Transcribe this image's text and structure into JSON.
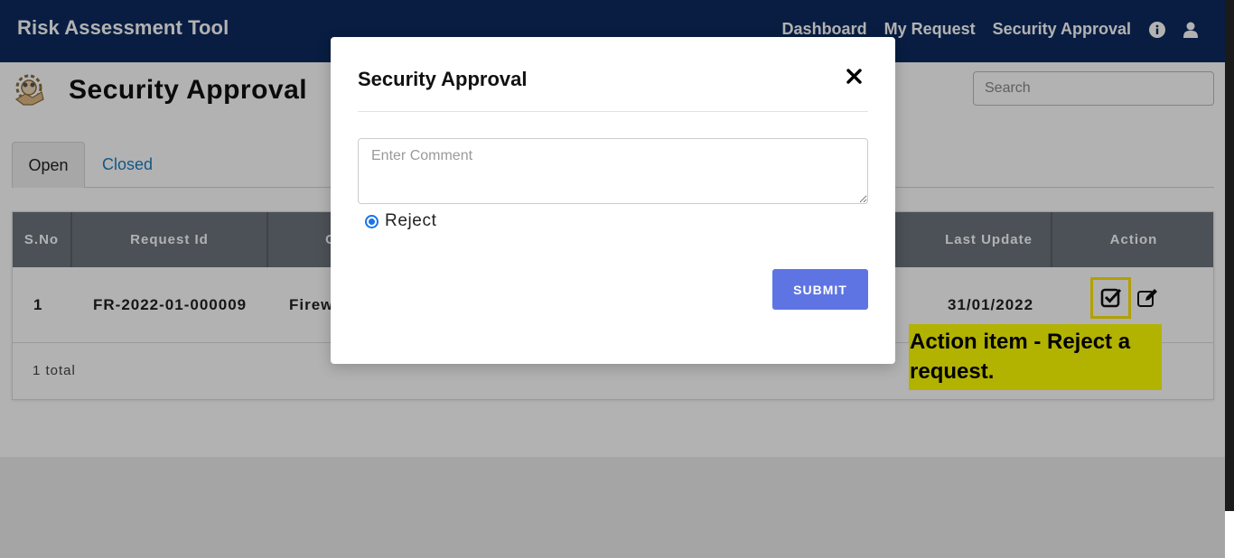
{
  "navbar": {
    "brand": "Risk Assessment Tool",
    "links": [
      "Dashboard",
      "My Request",
      "Security Approval"
    ],
    "icons": [
      "info-icon",
      "user-icon"
    ]
  },
  "page": {
    "title": "Security Approval",
    "search_placeholder": "Search"
  },
  "tabs": [
    "Open",
    "Closed"
  ],
  "table": {
    "columns": [
      "S.No",
      "Request Id",
      "C",
      "Last Update",
      "Action"
    ],
    "rows": [
      {
        "sno": "1",
        "request_id": "FR-2022-01-000009",
        "category": "Firew",
        "last_update": "31/01/2022"
      }
    ],
    "total": "1 total"
  },
  "annotation": {
    "line1": "Action item - Reject a",
    "line2": "request."
  },
  "modal": {
    "title": "Security Approval",
    "comment_placeholder": "Enter Comment",
    "option": "Reject",
    "submit_label": "SUBMIT"
  },
  "colors": {
    "navbar": "#0c2a5e",
    "table_header": "#6c757d",
    "submit": "#5f74e3",
    "highlight": "#ffff00",
    "tab_active_link": "#1b7fc1"
  }
}
